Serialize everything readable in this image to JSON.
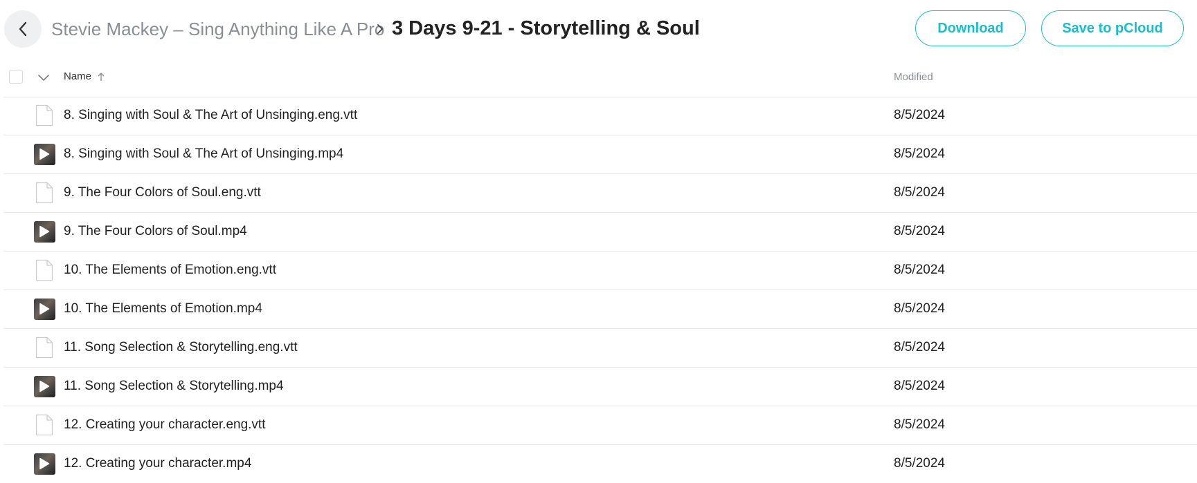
{
  "breadcrumb": {
    "parent": "Stevie Mackey – Sing Anything Like A Pro",
    "current": "3 Days 9-21 - Storytelling & Soul"
  },
  "actions": {
    "download_label": "Download",
    "save_label": "Save to pCloud"
  },
  "table": {
    "columns": {
      "name": "Name",
      "modified": "Modified"
    },
    "rows": [
      {
        "name": "8. Singing with Soul & The Art of Unsinging.eng.vtt",
        "modified": "8/5/2024",
        "type": "document"
      },
      {
        "name": "8. Singing with Soul & The Art of Unsinging.mp4",
        "modified": "8/5/2024",
        "type": "video"
      },
      {
        "name": "9. The Four Colors of Soul.eng.vtt",
        "modified": "8/5/2024",
        "type": "document"
      },
      {
        "name": "9. The Four Colors of Soul.mp4",
        "modified": "8/5/2024",
        "type": "video"
      },
      {
        "name": "10. The Elements of Emotion.eng.vtt",
        "modified": "8/5/2024",
        "type": "document"
      },
      {
        "name": "10. The Elements of Emotion.mp4",
        "modified": "8/5/2024",
        "type": "video"
      },
      {
        "name": "11. Song Selection & Storytelling.eng.vtt",
        "modified": "8/5/2024",
        "type": "document"
      },
      {
        "name": "11. Song Selection & Storytelling.mp4",
        "modified": "8/5/2024",
        "type": "video"
      },
      {
        "name": "12. Creating your character.eng.vtt",
        "modified": "8/5/2024",
        "type": "document"
      },
      {
        "name": "12. Creating your character.mp4",
        "modified": "8/5/2024",
        "type": "video"
      }
    ]
  },
  "colors": {
    "accent": "#17bed0",
    "muted_text": "#8a8f96",
    "divider": "#e6e8ea"
  },
  "icons": {
    "back": "chevron-left-icon",
    "separator": "chevron-right-icon",
    "sort": "arrow-up-icon",
    "select_menu": "chevron-down-icon",
    "document": "file-icon",
    "video": "video-thumbnail-play-icon"
  }
}
